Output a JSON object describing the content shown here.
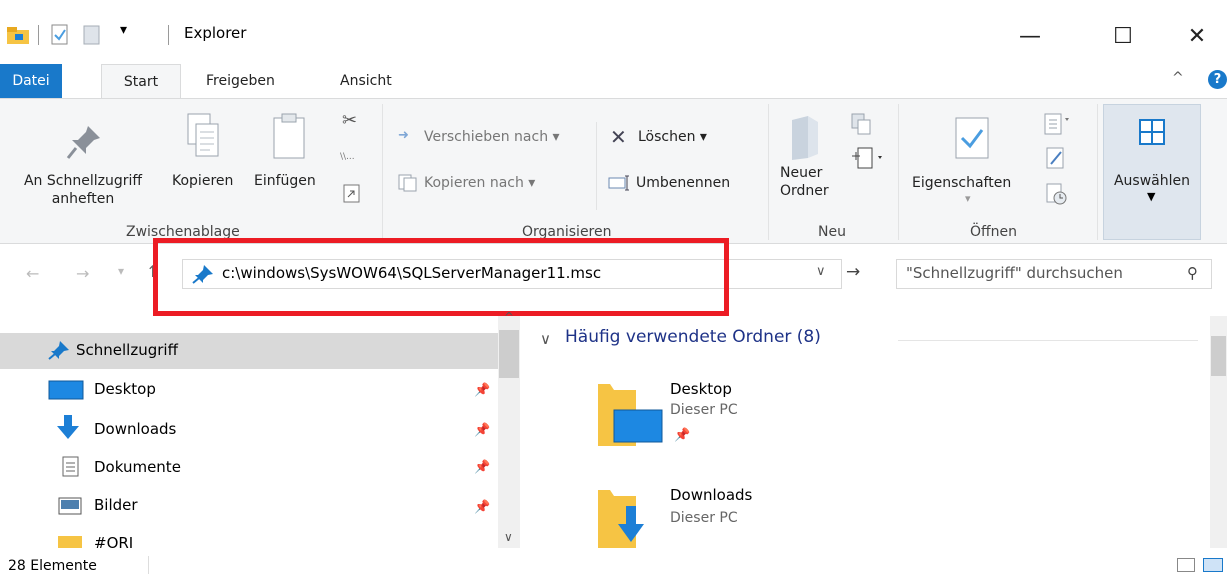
{
  "window": {
    "title": "Explorer",
    "controls": {
      "minimize": "—",
      "maximize": "☐",
      "close": "✕"
    }
  },
  "ribbon_tabs": [
    "Datei",
    "Start",
    "Freigeben",
    "Ansicht"
  ],
  "ribbon": {
    "zwischenablage": {
      "label": "Zwischenablage",
      "pin_label_1": "An Schnellzugriff",
      "pin_label_2": "anheften",
      "copy": "Kopieren",
      "paste": "Einfügen"
    },
    "organisieren": {
      "label": "Organisieren",
      "move": "Verschieben nach",
      "copy_to": "Kopieren nach",
      "delete": "Löschen",
      "rename": "Umbenennen"
    },
    "neu": {
      "label": "Neu",
      "new_folder_1": "Neuer",
      "new_folder_2": "Ordner"
    },
    "oeffnen": {
      "label": "Öffnen",
      "properties": "Eigenschaften"
    },
    "auswaehlen": {
      "label": "Auswählen"
    }
  },
  "address": {
    "path": "c:\\windows\\SysWOW64\\SQLServerManager11.msc",
    "search_placeholder": "\"Schnellzugriff\" durchsuchen"
  },
  "nav": {
    "quick_access": "Schnellzugriff",
    "items": [
      {
        "label": "Desktop",
        "icon": "desktop-icon"
      },
      {
        "label": "Downloads",
        "icon": "downloads-icon"
      },
      {
        "label": "Dokumente",
        "icon": "documents-icon"
      },
      {
        "label": "Bilder",
        "icon": "pictures-icon"
      },
      {
        "label": "#ORI",
        "icon": "folder-icon"
      }
    ]
  },
  "content": {
    "group_title": "Häufig verwendete Ordner (8)",
    "tiles": [
      {
        "name": "Desktop",
        "sub": "Dieser PC"
      },
      {
        "name": "Downloads",
        "sub": "Dieser PC"
      }
    ]
  },
  "status": {
    "count": "28 Elemente"
  },
  "colors": {
    "accent": "#1979ca",
    "highlight": "#ec1c24",
    "group_title": "#1e3287"
  }
}
